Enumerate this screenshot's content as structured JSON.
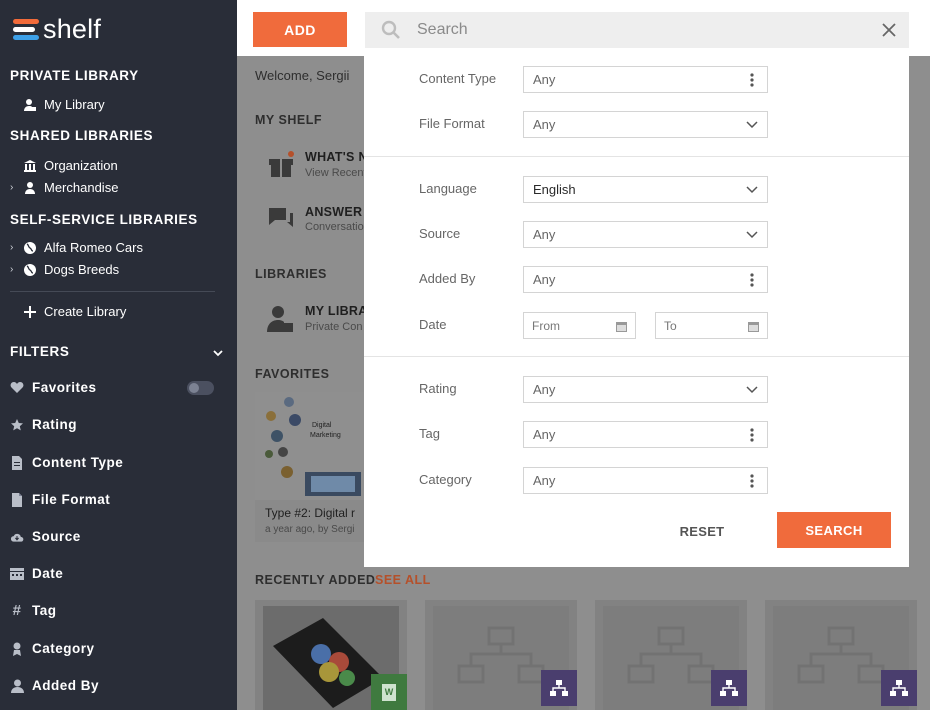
{
  "app": {
    "logo_text": "shelf"
  },
  "sidebar": {
    "private_title": "PRIVATE LIBRARY",
    "my_library": "My Library",
    "shared_title": "SHARED LIBRARIES",
    "organization": "Organization",
    "merchandise": "Merchandise",
    "self_service_title": "SELF-SERVICE LIBRARIES",
    "alfa_romeo": "Alfa Romeo Cars",
    "dogs_breeds": "Dogs Breeds",
    "create_library": "Create Library",
    "filters_title": "FILTERS",
    "filters": [
      {
        "label": "Favorites",
        "icon": "heart-icon"
      },
      {
        "label": "Rating",
        "icon": "star-icon"
      },
      {
        "label": "Content Type",
        "icon": "document-icon"
      },
      {
        "label": "File Format",
        "icon": "file-icon"
      },
      {
        "label": "Source",
        "icon": "cloud-icon"
      },
      {
        "label": "Date",
        "icon": "calendar-icon"
      },
      {
        "label": "Tag",
        "icon": "hash-icon"
      },
      {
        "label": "Category",
        "icon": "category-icon"
      },
      {
        "label": "Added By",
        "icon": "user-icon"
      }
    ]
  },
  "toolbar": {
    "add_label": "ADD",
    "search_placeholder": "Search"
  },
  "background": {
    "welcome": "Welcome, Sergii",
    "my_shelf": "MY SHELF",
    "whats_new": "WHAT'S N",
    "whats_new_sub": "View Recent",
    "answer": "ANSWER I",
    "answer_sub": "Conversatio",
    "libraries": "LIBRARIES",
    "my_library_card": "MY LIBRA",
    "my_library_sub": "Private Con",
    "favorites": "FAVORITES",
    "fav_title": "Type #2: Digital r",
    "fav_meta": "a year ago, by Sergi",
    "fav_img_line1": "Digital",
    "fav_img_line2": "Marketing",
    "recently_added": "RECENTLY ADDED",
    "see_all": "SEE ALL",
    "doc_badge": "W"
  },
  "modal": {
    "content_type": {
      "label": "Content Type",
      "value": "Any"
    },
    "file_format": {
      "label": "File Format",
      "value": "Any"
    },
    "language": {
      "label": "Language",
      "value": "English"
    },
    "source": {
      "label": "Source",
      "value": "Any"
    },
    "added_by": {
      "label": "Added By",
      "value": "Any"
    },
    "date": {
      "label": "Date",
      "from": "From",
      "to": "To"
    },
    "rating": {
      "label": "Rating",
      "value": "Any"
    },
    "tag": {
      "label": "Tag",
      "value": "Any"
    },
    "category": {
      "label": "Category",
      "value": "Any"
    },
    "reset_label": "RESET",
    "search_label": "SEARCH"
  },
  "colors": {
    "accent": "#f06b3c",
    "sidebar": "#292d38",
    "overlay": "#8e8e8e"
  }
}
